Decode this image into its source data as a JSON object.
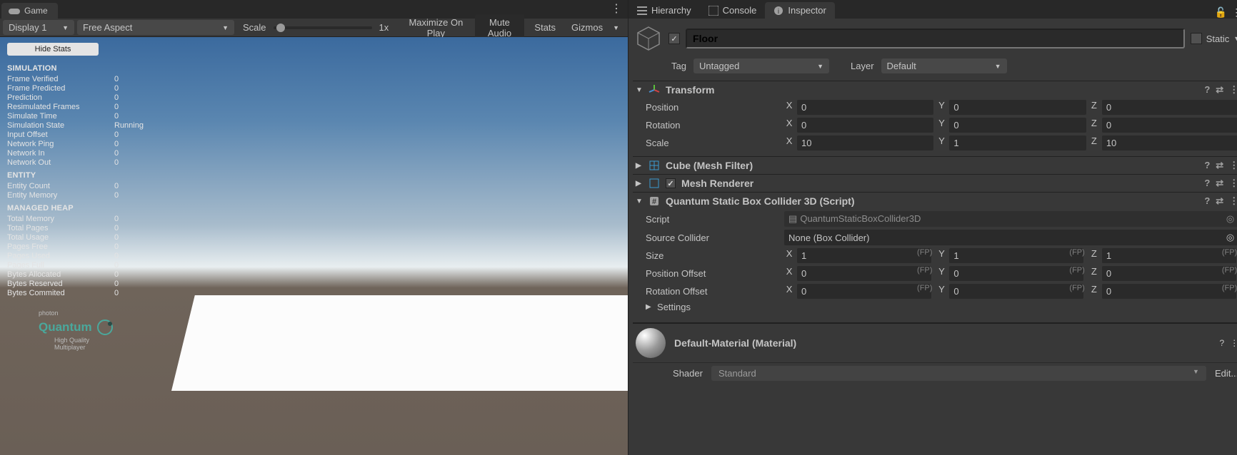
{
  "gameTab": {
    "label": "Game"
  },
  "gameToolbar": {
    "display": "Display 1",
    "aspect": "Free Aspect",
    "scaleLabel": "Scale",
    "scaleValue": "1x",
    "maximize": "Maximize On Play",
    "muteAudio": "Mute Audio",
    "stats": "Stats",
    "gizmos": "Gizmos"
  },
  "statsOverlay": {
    "hideBtn": "Hide Stats",
    "sections": {
      "SIMULATION": [
        {
          "k": "Frame Verified",
          "v": "0"
        },
        {
          "k": "Frame Predicted",
          "v": "0"
        },
        {
          "k": "Prediction",
          "v": "0"
        },
        {
          "k": "Resimulated Frames",
          "v": "0"
        },
        {
          "k": "Simulate Time",
          "v": "0"
        },
        {
          "k": "Simulation State",
          "v": "Running"
        },
        {
          "k": "Input Offset",
          "v": "0"
        },
        {
          "k": "Network Ping",
          "v": "0"
        },
        {
          "k": "Network In",
          "v": "0"
        },
        {
          "k": "Network Out",
          "v": "0"
        }
      ],
      "ENTITY": [
        {
          "k": "Entity Count",
          "v": "0"
        },
        {
          "k": "Entity Memory",
          "v": "0"
        }
      ],
      "MANAGED HEAP": [
        {
          "k": "Total Memory",
          "v": "0"
        },
        {
          "k": "Total Pages",
          "v": "0"
        },
        {
          "k": "Total Usage",
          "v": "0"
        },
        {
          "k": "Pages Free",
          "v": "0"
        },
        {
          "k": "Pages Used",
          "v": "0"
        },
        {
          "k": "Pages Full",
          "v": "0"
        },
        {
          "k": "Bytes Allocated",
          "v": "0"
        },
        {
          "k": "Bytes Reserved",
          "v": "0"
        },
        {
          "k": "Bytes Commited",
          "v": "0"
        }
      ]
    },
    "logo": {
      "photon": "photon",
      "quantum": "Quantum",
      "tag1": "High Quality",
      "tag2": "Multiplayer"
    }
  },
  "rightTabs": {
    "hierarchy": "Hierarchy",
    "console": "Console",
    "inspector": "Inspector"
  },
  "inspector": {
    "objectName": "Floor",
    "staticLabel": "Static",
    "tagLabel": "Tag",
    "tagValue": "Untagged",
    "layerLabel": "Layer",
    "layerValue": "Default",
    "transform": {
      "title": "Transform",
      "position": {
        "lbl": "Position",
        "x": "0",
        "y": "0",
        "z": "0"
      },
      "rotation": {
        "lbl": "Rotation",
        "x": "0",
        "y": "0",
        "z": "0"
      },
      "scale": {
        "lbl": "Scale",
        "x": "10",
        "y": "1",
        "z": "10"
      }
    },
    "meshFilter": {
      "title": "Cube (Mesh Filter)"
    },
    "meshRenderer": {
      "title": "Mesh Renderer"
    },
    "collider": {
      "title": "Quantum Static Box Collider 3D (Script)",
      "script": {
        "lbl": "Script",
        "val": "QuantumStaticBoxCollider3D"
      },
      "sourceCollider": {
        "lbl": "Source Collider",
        "val": "None (Box Collider)"
      },
      "size": {
        "lbl": "Size",
        "x": "1",
        "y": "1",
        "z": "1",
        "fp": "(FP)"
      },
      "posOff": {
        "lbl": "Position Offset",
        "x": "0",
        "y": "0",
        "z": "0",
        "fp": "(FP)"
      },
      "rotOff": {
        "lbl": "Rotation Offset",
        "x": "0",
        "y": "0",
        "z": "0",
        "fp": "(FP)"
      },
      "settings": "Settings"
    },
    "material": {
      "title": "Default-Material (Material)",
      "shaderLbl": "Shader",
      "shaderVal": "Standard",
      "edit": "Edit..."
    }
  }
}
